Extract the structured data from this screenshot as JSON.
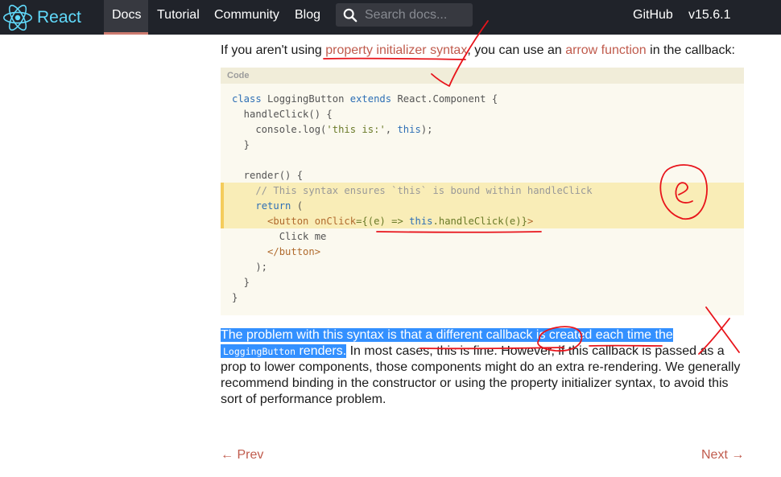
{
  "nav": {
    "brand": "React",
    "links": [
      "Docs",
      "Tutorial",
      "Community",
      "Blog"
    ],
    "search_placeholder": "Search docs...",
    "github": "GitHub",
    "version": "v15.6.1"
  },
  "intro": {
    "before": "If you aren't using ",
    "link1": "property initializer syntax",
    "middle": ", you can use an ",
    "link2": "arrow function",
    "after": " in the callback:"
  },
  "code": {
    "header": "Code",
    "lines": [
      "class LoggingButton extends React.Component {",
      "  handleClick() {",
      "    console.log('this is:', this);",
      "  }",
      "",
      "  render() {",
      "    // This syntax ensures `this` is bound within handleClick",
      "    return (",
      "      <button onClick={(e) => this.handleClick(e)}>",
      "        Click me",
      "      </button>",
      "    );",
      "  }",
      "}"
    ]
  },
  "body": {
    "line1": "The problem with this syntax is that a different callback is created each time the",
    "component": "LoggingButton",
    "renders": " renders.",
    "rest1": " In most cases, this is fine. However, if this callback is passed as a",
    "line3": "prop to lower components, those components might do an extra re-rendering. We generally",
    "line4": "recommend binding in the constructor or using the property initializer syntax, to avoid this",
    "line5": "sort of performance problem."
  },
  "pager": {
    "prev": "← Prev",
    "next": "Next →"
  },
  "colors": {
    "nav_bg": "#20232a",
    "brand": "#61dafb",
    "link": "#c05b4d",
    "selection": "#3390ff",
    "annotation": "#e8141b"
  }
}
